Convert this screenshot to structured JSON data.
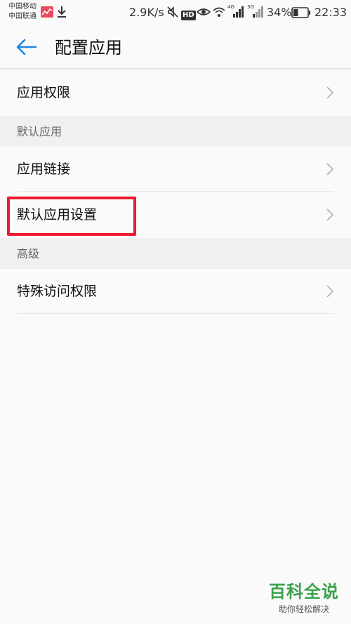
{
  "status_bar": {
    "carrier_1": "中国移动",
    "carrier_2": "中国联通",
    "net_speed": "2.9K/s",
    "hd_badge": "HD",
    "net_4g": "4G",
    "net_3g": "3G",
    "battery_percent": "34%",
    "time": "22:33",
    "battery_level": 0.34
  },
  "app_bar": {
    "title": "配置应用"
  },
  "rows": {
    "app_permissions": "应用权限",
    "app_links": "应用链接",
    "default_app_settings": "默认应用设置",
    "special_access": "特殊访问权限"
  },
  "sections": {
    "default_apps": "默认应用",
    "advanced": "高级"
  },
  "watermark": {
    "title": "百科全说",
    "subtitle": "助你轻松解决"
  },
  "colors": {
    "accent": "#1e88e5",
    "highlight": "#ee1b2e",
    "watermark_green": "#3aa24a"
  }
}
